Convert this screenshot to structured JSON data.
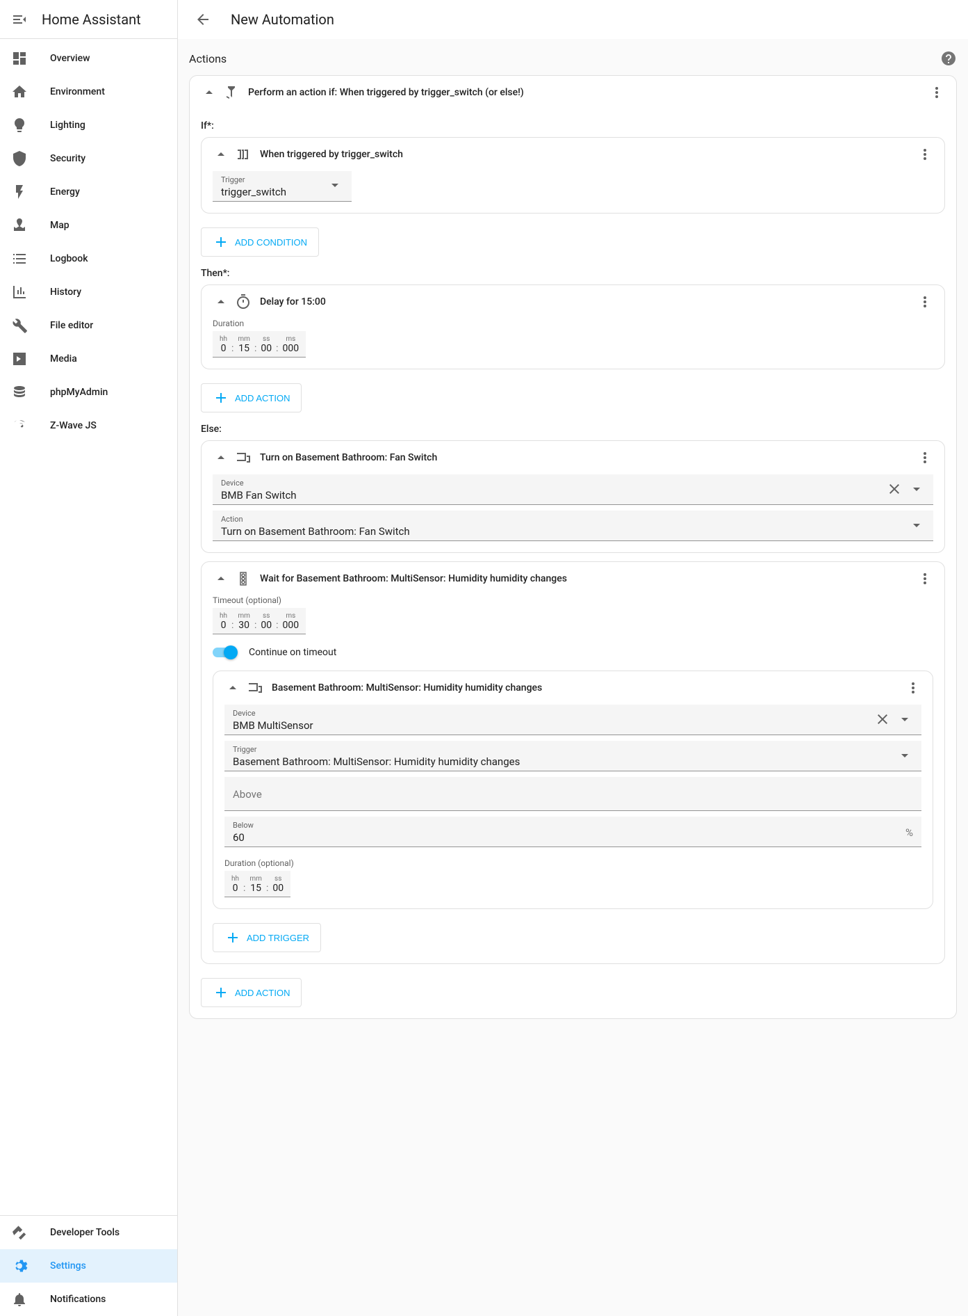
{
  "app_title": "Home Assistant",
  "page_title": "New Automation",
  "sidebar": {
    "items": [
      {
        "label": "Overview"
      },
      {
        "label": "Environment"
      },
      {
        "label": "Lighting"
      },
      {
        "label": "Security"
      },
      {
        "label": "Energy"
      },
      {
        "label": "Map"
      },
      {
        "label": "Logbook"
      },
      {
        "label": "History"
      },
      {
        "label": "File editor"
      },
      {
        "label": "Media"
      },
      {
        "label": "phpMyAdmin"
      },
      {
        "label": "Z-Wave JS"
      }
    ],
    "bottom": [
      {
        "label": "Developer Tools"
      },
      {
        "label": "Settings"
      },
      {
        "label": "Notifications"
      }
    ]
  },
  "section_title": "Actions",
  "action1": {
    "title": "Perform an action if: When triggered by trigger_switch (or else!)",
    "if_label": "If*:",
    "condition": {
      "title": "When triggered by trigger_switch",
      "trigger_label": "Trigger",
      "trigger_value": "trigger_switch"
    },
    "add_condition": "ADD CONDITION",
    "then_label": "Then*:",
    "delay": {
      "title": "Delay for 15:00",
      "duration_label": "Duration",
      "hh": "0",
      "mm": "15",
      "ss": "00",
      "ms": "000",
      "hh_l": "hh",
      "mm_l": "mm",
      "ss_l": "ss",
      "ms_l": "ms"
    },
    "add_action": "ADD ACTION",
    "else_label": "Else:",
    "turn_on": {
      "title": "Turn on Basement Bathroom: Fan Switch",
      "device_label": "Device",
      "device_value": "BMB Fan Switch",
      "action_label": "Action",
      "action_value": "Turn on Basement Bathroom: Fan Switch"
    },
    "wait": {
      "title": "Wait for Basement Bathroom: MultiSensor: Humidity humidity changes",
      "timeout_label": "Timeout (optional)",
      "hh": "0",
      "mm": "30",
      "ss": "00",
      "ms": "000",
      "continue_label": "Continue on timeout",
      "inner": {
        "title": "Basement Bathroom: MultiSensor: Humidity humidity changes",
        "device_label": "Device",
        "device_value": "BMB MultiSensor",
        "trigger_label": "Trigger",
        "trigger_value": "Basement Bathroom: MultiSensor: Humidity humidity changes",
        "above_placeholder": "Above",
        "below_label": "Below",
        "below_value": "60",
        "below_suffix": "%",
        "duration_label": "Duration (optional)",
        "d_hh": "0",
        "d_mm": "15",
        "d_ss": "00"
      },
      "add_trigger": "ADD TRIGGER"
    },
    "add_action_bottom": "ADD ACTION"
  }
}
